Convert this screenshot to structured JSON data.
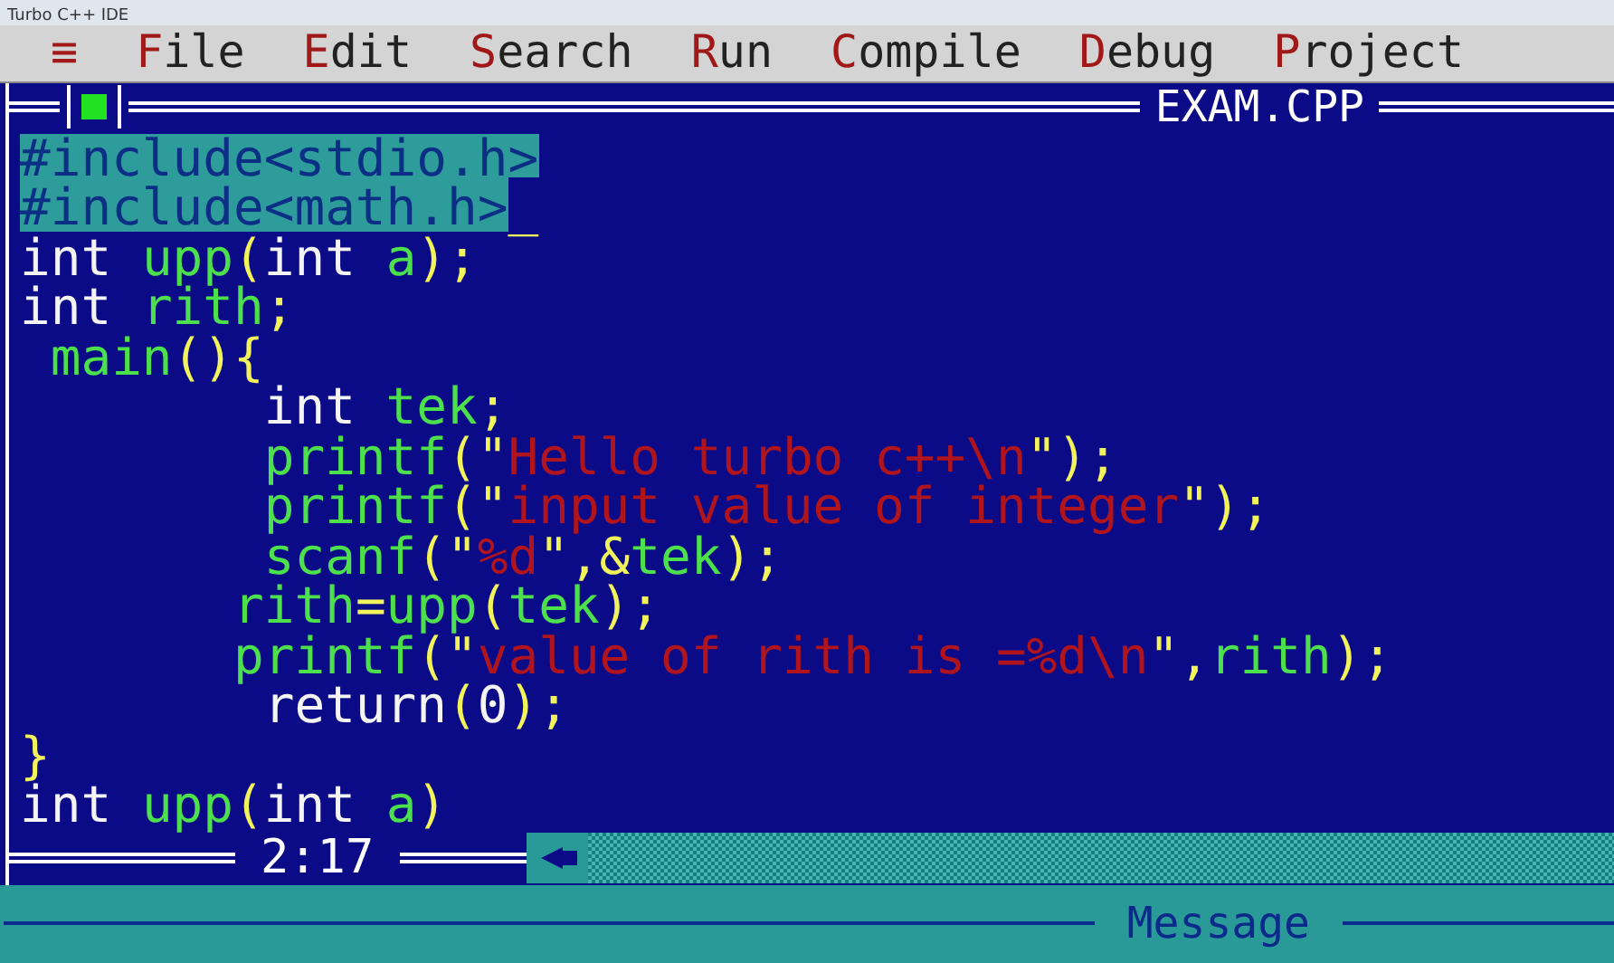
{
  "window": {
    "title": "Turbo C++ IDE"
  },
  "menu": [
    {
      "label": "≡"
    },
    {
      "label": "File"
    },
    {
      "label": "Edit"
    },
    {
      "label": "Search"
    },
    {
      "label": "Run"
    },
    {
      "label": "Compile"
    },
    {
      "label": "Debug"
    },
    {
      "label": "Project"
    }
  ],
  "editor": {
    "title": "EXAM.CPP",
    "position": "2:17",
    "lines": [
      {
        "selected": true,
        "tokens": [
          {
            "kind": "plain",
            "text": "#include<stdio.h>"
          }
        ]
      },
      {
        "selected": true,
        "tokens": [
          {
            "kind": "plain",
            "text": "#include<math.h>"
          },
          {
            "kind": "cursor",
            "text": "_"
          }
        ]
      },
      {
        "selected": false,
        "tokens": [
          {
            "kind": "plain",
            "text": "int "
          },
          {
            "kind": "ident",
            "text": "upp"
          },
          {
            "kind": "punct",
            "text": "("
          },
          {
            "kind": "plain",
            "text": "int "
          },
          {
            "kind": "ident",
            "text": "a"
          },
          {
            "kind": "punct",
            "text": ");"
          }
        ]
      },
      {
        "selected": false,
        "tokens": [
          {
            "kind": "plain",
            "text": "int "
          },
          {
            "kind": "ident",
            "text": "rith"
          },
          {
            "kind": "punct",
            "text": ";"
          }
        ]
      },
      {
        "selected": false,
        "tokens": [
          {
            "kind": "ident",
            "text": " main"
          },
          {
            "kind": "punct",
            "text": "(){"
          }
        ]
      },
      {
        "selected": false,
        "tokens": [
          {
            "kind": "plain",
            "text": "        int "
          },
          {
            "kind": "ident",
            "text": "tek"
          },
          {
            "kind": "punct",
            "text": ";"
          }
        ]
      },
      {
        "selected": false,
        "tokens": [
          {
            "kind": "ident",
            "text": "        printf"
          },
          {
            "kind": "punct",
            "text": "(\""
          },
          {
            "kind": "string",
            "text": "Hello turbo c++\\n"
          },
          {
            "kind": "punct",
            "text": "\");"
          }
        ]
      },
      {
        "selected": false,
        "tokens": [
          {
            "kind": "ident",
            "text": "        printf"
          },
          {
            "kind": "punct",
            "text": "(\""
          },
          {
            "kind": "string",
            "text": "input value of integer"
          },
          {
            "kind": "punct",
            "text": "\");"
          }
        ]
      },
      {
        "selected": false,
        "tokens": [
          {
            "kind": "ident",
            "text": "        scanf"
          },
          {
            "kind": "punct",
            "text": "(\""
          },
          {
            "kind": "string",
            "text": "%d"
          },
          {
            "kind": "punct",
            "text": "\",&"
          },
          {
            "kind": "ident",
            "text": "tek"
          },
          {
            "kind": "punct",
            "text": ");"
          }
        ]
      },
      {
        "selected": false,
        "tokens": [
          {
            "kind": "ident",
            "text": "       rith"
          },
          {
            "kind": "punct",
            "text": "="
          },
          {
            "kind": "ident",
            "text": "upp"
          },
          {
            "kind": "punct",
            "text": "("
          },
          {
            "kind": "ident",
            "text": "tek"
          },
          {
            "kind": "punct",
            "text": ");"
          }
        ]
      },
      {
        "selected": false,
        "tokens": [
          {
            "kind": "ident",
            "text": "       printf"
          },
          {
            "kind": "punct",
            "text": "(\""
          },
          {
            "kind": "string",
            "text": "value of rith is =%d\\n"
          },
          {
            "kind": "punct",
            "text": "\","
          },
          {
            "kind": "ident",
            "text": "rith"
          },
          {
            "kind": "punct",
            "text": ");"
          }
        ]
      },
      {
        "selected": false,
        "tokens": [
          {
            "kind": "plain",
            "text": "        return"
          },
          {
            "kind": "punct",
            "text": "("
          },
          {
            "kind": "plain",
            "text": "0"
          },
          {
            "kind": "punct",
            "text": ");"
          }
        ]
      },
      {
        "selected": false,
        "tokens": [
          {
            "kind": "punct",
            "text": "}"
          }
        ]
      },
      {
        "selected": false,
        "tokens": [
          {
            "kind": "plain",
            "text": "int "
          },
          {
            "kind": "ident",
            "text": "upp"
          },
          {
            "kind": "punct",
            "text": "("
          },
          {
            "kind": "plain",
            "text": "int "
          },
          {
            "kind": "ident",
            "text": "a"
          },
          {
            "kind": "punct",
            "text": ")"
          }
        ]
      }
    ]
  },
  "message_pane": {
    "title": "Message"
  }
}
